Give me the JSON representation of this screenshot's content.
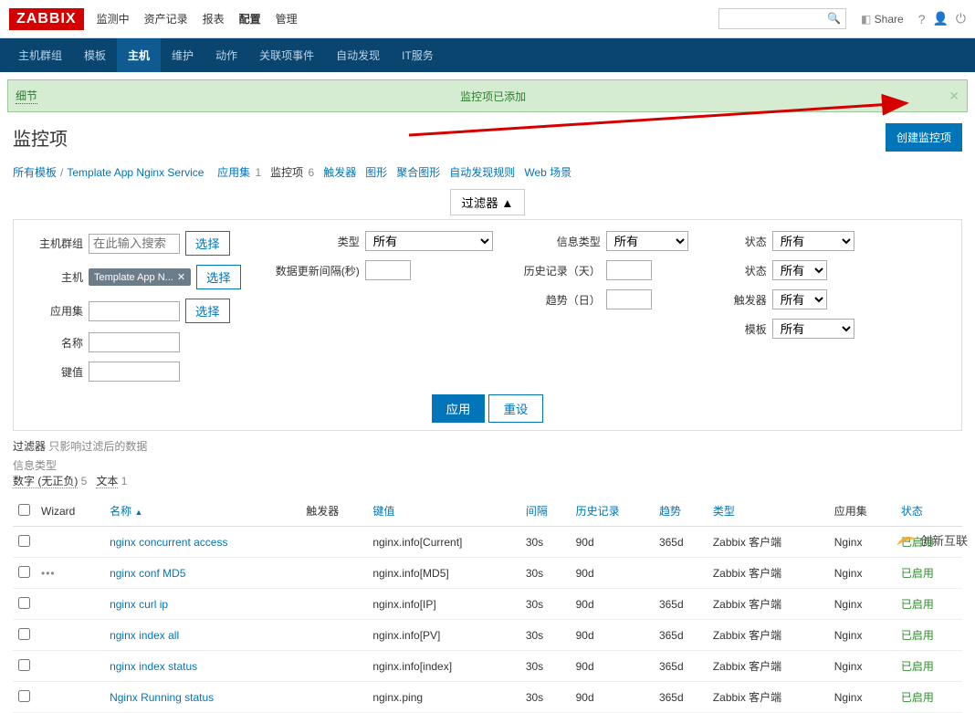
{
  "logo": "ZABBIX",
  "topnav": [
    "监测中",
    "资产记录",
    "报表",
    "配置",
    "管理"
  ],
  "topnav_selected": 3,
  "share_label": "Share",
  "subnav": [
    "主机群组",
    "模板",
    "主机",
    "维护",
    "动作",
    "关联项事件",
    "自动发现",
    "IT服务"
  ],
  "subnav_active": 2,
  "message": {
    "detail": "细节",
    "text": "监控项已添加"
  },
  "page_title": "监控项",
  "create_button": "创建监控项",
  "breadcrumb": {
    "all_templates": "所有模板",
    "template_name": "Template App Nginx Service",
    "items": [
      {
        "label": "应用集",
        "count": "1"
      },
      {
        "label": "监控项",
        "count": "6",
        "active": true
      },
      {
        "label": "触发器",
        "count": ""
      },
      {
        "label": "图形",
        "count": ""
      },
      {
        "label": "聚合图形",
        "count": ""
      },
      {
        "label": "自动发现规则",
        "count": ""
      },
      {
        "label": "Web 场景",
        "count": ""
      }
    ]
  },
  "filter_toggle": "过滤器 ▲",
  "filter": {
    "labels": {
      "hostgroup": "主机群组",
      "host": "主机",
      "appset": "应用集",
      "name": "名称",
      "key": "键值",
      "type": "类型",
      "interval": "数据更新间隔(秒)",
      "info_type": "信息类型",
      "history": "历史记录（天）",
      "trend": "趋势（日）",
      "status1": "状态",
      "status2": "状态",
      "trigger": "触发器",
      "template": "模板"
    },
    "placeholder": "在此输入搜索",
    "select_btn": "选择",
    "host_badge": "Template App N...",
    "all_option": "所有",
    "apply": "应用",
    "reset": "重设"
  },
  "filter_note": {
    "prefix": "过滤器",
    "text": "只影响过滤后的数据"
  },
  "info_types": {
    "label": "信息类型",
    "t1": "数字 (无正负)",
    "c1": "5",
    "t2": "文本",
    "c2": "1"
  },
  "table": {
    "headers": {
      "cb": "",
      "wizard": "Wizard",
      "name": "名称",
      "triggers": "触发器",
      "key": "键值",
      "interval": "间隔",
      "history": "历史记录",
      "trend": "趋势",
      "type": "类型",
      "appset": "应用集",
      "status": "状态"
    },
    "rows": [
      {
        "wiz": "",
        "name": "nginx concurrent access",
        "trig": "",
        "key": "nginx.info[Current]",
        "int": "30s",
        "hist": "90d",
        "trend": "365d",
        "type": "Zabbix 客户端",
        "app": "Nginx",
        "status": "已启用"
      },
      {
        "wiz": "dots",
        "name": "nginx conf MD5",
        "trig": "",
        "key": "nginx.info[MD5]",
        "int": "30s",
        "hist": "90d",
        "trend": "",
        "type": "Zabbix 客户端",
        "app": "Nginx",
        "status": "已启用"
      },
      {
        "wiz": "",
        "name": "nginx curl ip",
        "trig": "",
        "key": "nginx.info[IP]",
        "int": "30s",
        "hist": "90d",
        "trend": "365d",
        "type": "Zabbix 客户端",
        "app": "Nginx",
        "status": "已启用"
      },
      {
        "wiz": "",
        "name": "nginx index all",
        "trig": "",
        "key": "nginx.info[PV]",
        "int": "30s",
        "hist": "90d",
        "trend": "365d",
        "type": "Zabbix 客户端",
        "app": "Nginx",
        "status": "已启用"
      },
      {
        "wiz": "",
        "name": "nginx index status",
        "trig": "",
        "key": "nginx.info[index]",
        "int": "30s",
        "hist": "90d",
        "trend": "365d",
        "type": "Zabbix 客户端",
        "app": "Nginx",
        "status": "已启用"
      },
      {
        "wiz": "",
        "name": "Nginx Running status",
        "trig": "",
        "key": "nginx.ping",
        "int": "30s",
        "hist": "90d",
        "trend": "365d",
        "type": "Zabbix 客户端",
        "app": "Nginx",
        "status": "已启用"
      }
    ]
  },
  "watermark": "创新互联"
}
